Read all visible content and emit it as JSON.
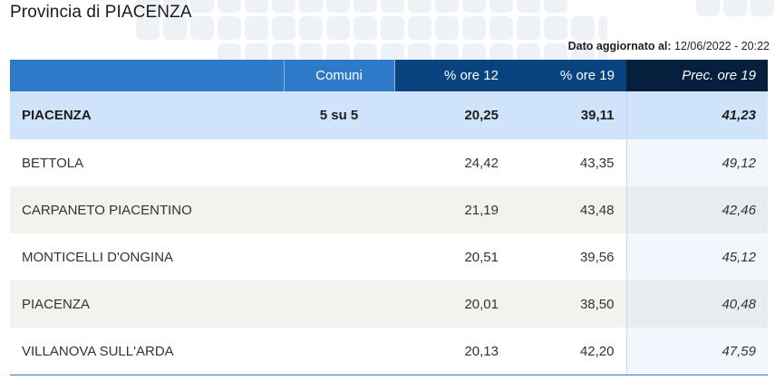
{
  "title": "Provincia di PIACENZA",
  "updated": {
    "label": "Dato aggiornato al:",
    "value": "12/06/2022 - 20:22"
  },
  "table": {
    "headers": {
      "name": "",
      "comuni": "Comuni",
      "ore12": "% ore 12",
      "ore19": "% ore 19",
      "prec19": "Prec. ore 19"
    },
    "total": {
      "name": "PIACENZA",
      "comuni": "5 su 5",
      "ore12": "20,25",
      "ore19": "39,11",
      "prec19": "41,23"
    },
    "rows": [
      {
        "name": "BETTOLA",
        "comuni": "",
        "ore12": "24,42",
        "ore19": "43,35",
        "prec19": "49,12"
      },
      {
        "name": "CARPANETO PIACENTINO",
        "comuni": "",
        "ore12": "21,19",
        "ore19": "43,48",
        "prec19": "42,46"
      },
      {
        "name": "MONTICELLI D'ONGINA",
        "comuni": "",
        "ore12": "20,51",
        "ore19": "39,56",
        "prec19": "45,12"
      },
      {
        "name": "PIACENZA",
        "comuni": "",
        "ore12": "20,01",
        "ore19": "38,50",
        "prec19": "40,48"
      },
      {
        "name": "VILLANOVA SULL'ARDA",
        "comuni": "",
        "ore12": "20,13",
        "ore19": "42,20",
        "prec19": "47,59"
      }
    ]
  },
  "colors": {
    "header_light": "#2f79c9",
    "header_dark": "#08437f",
    "header_darkest": "#061f3d",
    "total_row": "#cfe3fa",
    "stripe": "#f2f3ee"
  }
}
